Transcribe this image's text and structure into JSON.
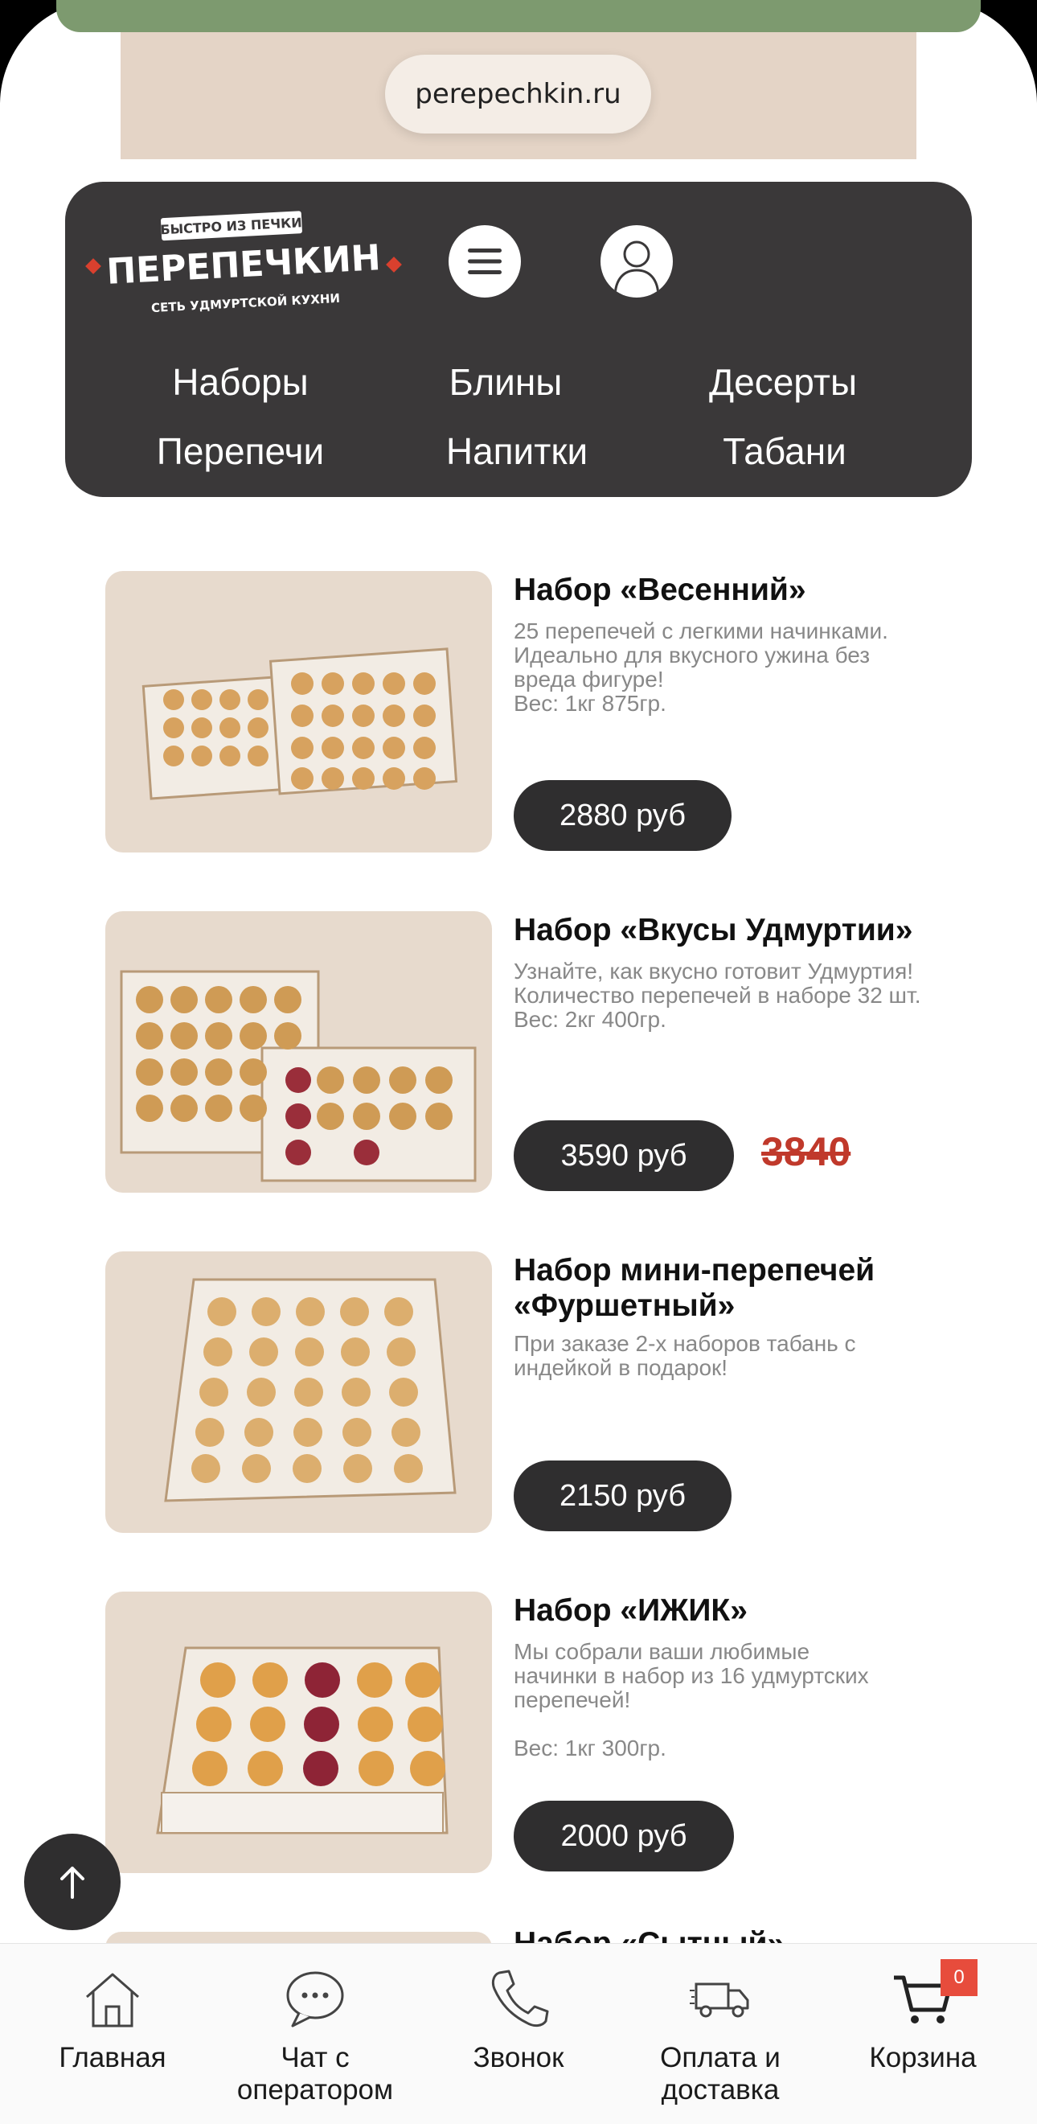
{
  "browser": {
    "url": "perepechkin.ru"
  },
  "header": {
    "logo": {
      "top_text": "БЫСТРО ИЗ ПЕЧКИ",
      "name": "ПЕРЕПЕЧКИН",
      "bottom_text": "СЕТЬ УДМУРТСКОЙ КУХНИ"
    },
    "categories": [
      "Наборы",
      "Блины",
      "Десерты",
      "Перепечи",
      "Напитки",
      "Табани"
    ]
  },
  "products": [
    {
      "title": "Набор «Весенний»",
      "description": "25 перепечей с легкими начинками.\nИдеально для вкусного ужина без\nвреда фигуре!\nВес: 1кг 875гр.",
      "price": "2880 руб"
    },
    {
      "title": "Набор «Вкусы Удмуртии»",
      "description": "Узнайте, как вкусно готовит Удмуртия!\nКоличество перепечей в наборе 32 шт.\nВес: 2кг 400гр.",
      "price": "3590 руб",
      "old_price": "3840"
    },
    {
      "title": "Набор мини-перепечей «Фуршетный»",
      "description": "При заказе 2-х наборов табань с\nиндейкой в подарок!",
      "price": "2150 руб"
    },
    {
      "title": "Набор «ИЖИК»",
      "description": "Мы собрали ваши любимые\nначинки в набор из 16 удмуртских\nперепечей!\n\nВес: 1кг 300гр.",
      "price": "2000 руб"
    }
  ],
  "partial_product_title": "Набор «Сытный»",
  "bottom_nav": [
    {
      "label": "Главная",
      "icon": "home-icon"
    },
    {
      "label": "Чат с\nоператором",
      "icon": "chat-icon"
    },
    {
      "label": "Звонок",
      "icon": "phone-icon"
    },
    {
      "label": "Оплата и\nдоставка",
      "icon": "delivery-truck-icon"
    },
    {
      "label": "Корзина",
      "icon": "cart-icon"
    }
  ],
  "cart_count": "0",
  "colors": {
    "dark": "#3a3839",
    "accent_red": "#c0392b",
    "badge": "#e74c3c",
    "card_bg": "#e7dacd"
  }
}
